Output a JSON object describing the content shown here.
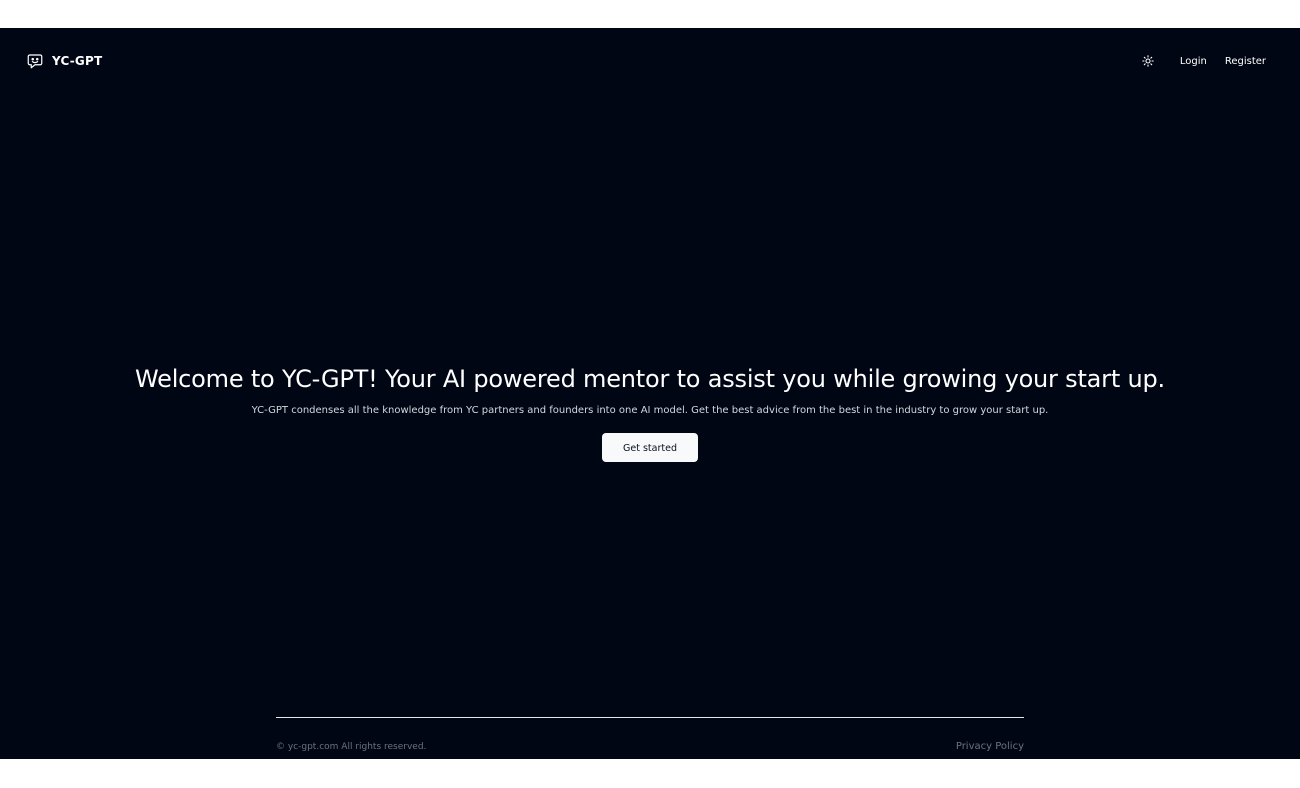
{
  "nav": {
    "brand_name": "YC-GPT",
    "brand_icon": "chatbot-face-icon",
    "theme_toggle_icon": "sun-icon",
    "links": [
      {
        "label": "Login"
      },
      {
        "label": "Register"
      }
    ]
  },
  "hero": {
    "title": "Welcome to YC-GPT! Your AI powered mentor to assist you while growing your start up.",
    "subtitle": "YC-GPT condenses all the knowledge from YC partners and founders into one AI model. Get the best advice from the best in the industry to grow your start up.",
    "cta_label": "Get started"
  },
  "footer": {
    "copyright": "© yc-gpt.com All rights reserved.",
    "privacy_label": "Privacy Policy"
  },
  "colors": {
    "background": "#010614",
    "text": "#ffffff",
    "muted": "#6b7280",
    "button_bg": "#f8f9fb"
  }
}
